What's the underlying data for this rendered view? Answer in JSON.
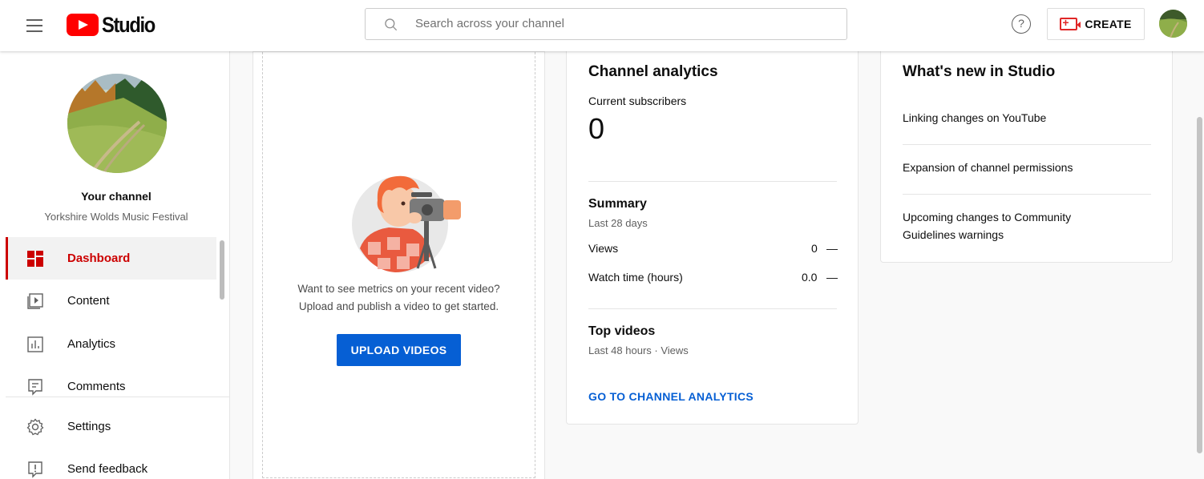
{
  "header": {
    "logo_text": "Studio",
    "search_placeholder": "Search across your channel",
    "create_label": "CREATE",
    "help_glyph": "?"
  },
  "sidebar": {
    "channel_title": "Your channel",
    "channel_name": "Yorkshire Wolds Music Festival",
    "items": [
      {
        "label": "Dashboard",
        "icon": "dashboard-icon",
        "active": true
      },
      {
        "label": "Content",
        "icon": "content-icon"
      },
      {
        "label": "Analytics",
        "icon": "analytics-icon"
      },
      {
        "label": "Comments",
        "icon": "comments-icon"
      },
      {
        "label": "Settings",
        "icon": "gear-icon"
      },
      {
        "label": "Send feedback",
        "icon": "feedback-icon"
      }
    ]
  },
  "upload": {
    "line1": "Want to see metrics on your recent video?",
    "line2": "Upload and publish a video to get started.",
    "button_label": "UPLOAD VIDEOS"
  },
  "analytics": {
    "title": "Channel analytics",
    "subscribers_label": "Current subscribers",
    "subscribers_value": "0",
    "summary_title": "Summary",
    "summary_period": "Last 28 days",
    "rows": [
      {
        "label": "Views",
        "value": "0",
        "trend": "—"
      },
      {
        "label": "Watch time (hours)",
        "value": "0.0",
        "trend": "—"
      }
    ],
    "top_videos_title": "Top videos",
    "top_videos_sub": "Last 48 hours · Views",
    "link_label": "GO TO CHANNEL ANALYTICS"
  },
  "whats_new": {
    "title": "What's new in Studio",
    "items": [
      {
        "label": "Linking changes on YouTube"
      },
      {
        "label": "Expansion of channel permissions"
      },
      {
        "label": "Upcoming changes to Community Guidelines warnings"
      }
    ]
  },
  "colors": {
    "accent_blue": "#065fd4",
    "active_red": "#cc0000",
    "brand_red": "#ff0000"
  }
}
